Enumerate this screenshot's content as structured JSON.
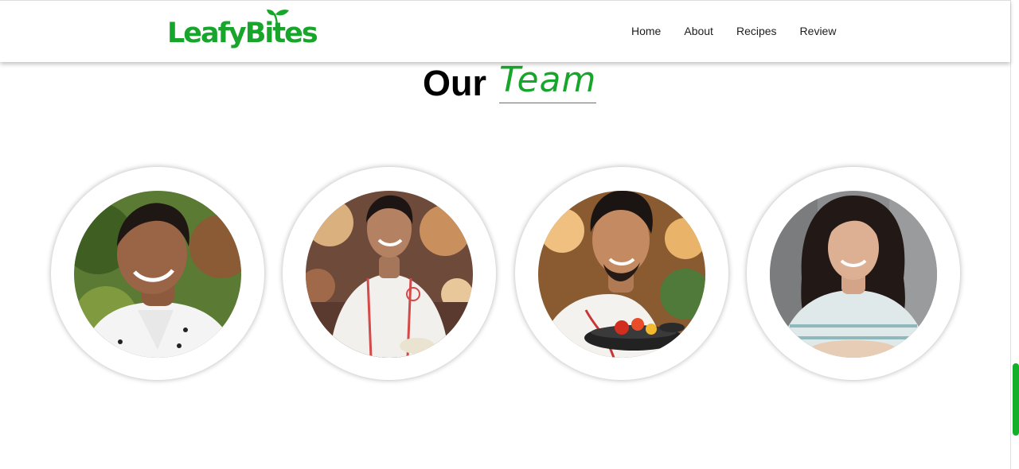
{
  "brand": {
    "name": "LeafyBites",
    "accent_color": "#17a52b"
  },
  "nav": {
    "items": [
      {
        "label": "Home"
      },
      {
        "label": "About"
      },
      {
        "label": "Recipes"
      },
      {
        "label": "Review"
      }
    ]
  },
  "section": {
    "title_plain": "Our",
    "title_accent": "Team"
  },
  "team": [
    {
      "photo": "chef-portrait-1"
    },
    {
      "photo": "chef-portrait-2"
    },
    {
      "photo": "chef-portrait-3"
    },
    {
      "photo": "chef-portrait-4"
    }
  ],
  "scrollbar": {
    "thumb_color": "#14b02a"
  }
}
